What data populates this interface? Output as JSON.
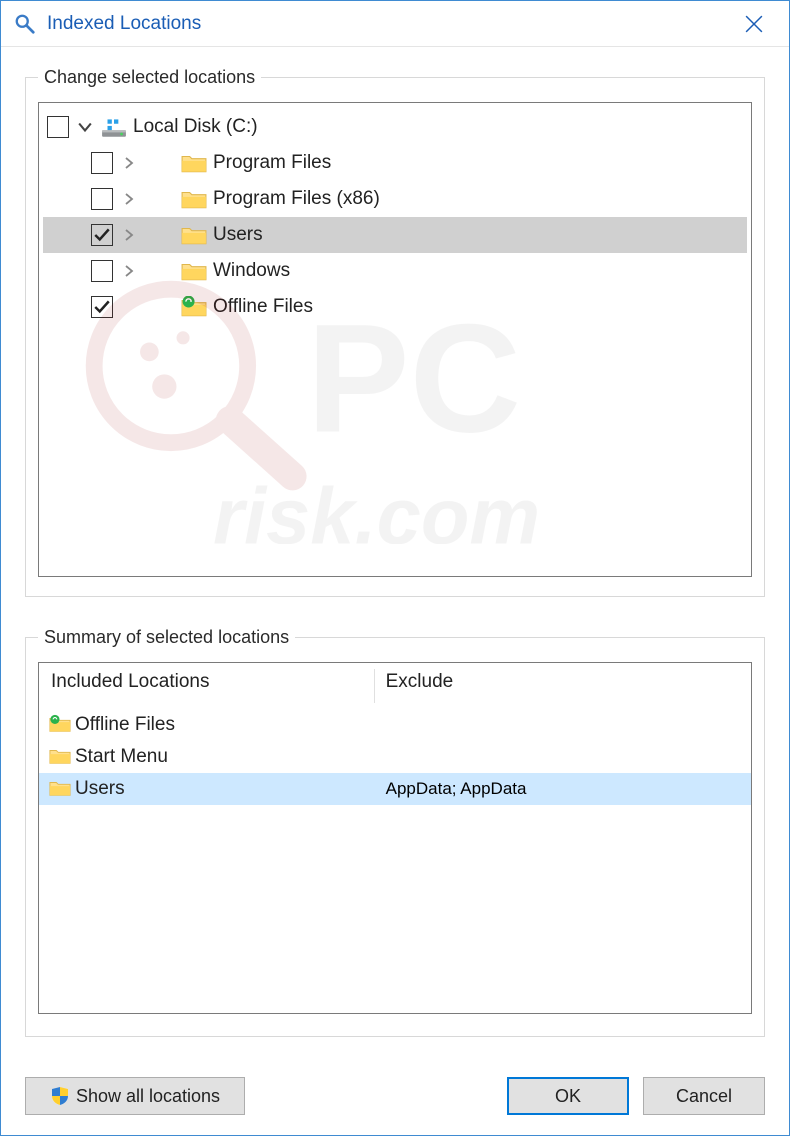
{
  "title": "Indexed Locations",
  "fieldset_top_legend": "Change selected locations",
  "fieldset_bottom_legend": "Summary of selected locations",
  "tree": [
    {
      "label": "Local Disk (C:)",
      "checked": false,
      "expanded": true,
      "icon": "disk",
      "depth": 0,
      "selected": false
    },
    {
      "label": "Program Files",
      "checked": false,
      "expanded": false,
      "icon": "folder",
      "depth": 1,
      "selected": false
    },
    {
      "label": "Program Files (x86)",
      "checked": false,
      "expanded": false,
      "icon": "folder",
      "depth": 1,
      "selected": false
    },
    {
      "label": "Users",
      "checked": true,
      "expanded": false,
      "icon": "folder",
      "depth": 1,
      "selected": true
    },
    {
      "label": "Windows",
      "checked": false,
      "expanded": false,
      "icon": "folder",
      "depth": 1,
      "selected": false
    },
    {
      "label": "Offline Files",
      "checked": true,
      "expanded": null,
      "icon": "offline",
      "depth": 1,
      "selected": false
    }
  ],
  "summary": {
    "included_header": "Included Locations",
    "exclude_header": "Exclude",
    "rows": [
      {
        "label": "Offline Files",
        "icon": "offline",
        "exclude": "",
        "selected": false
      },
      {
        "label": "Start Menu",
        "icon": "folder",
        "exclude": "",
        "selected": false
      },
      {
        "label": "Users",
        "icon": "folder",
        "exclude": "AppData; AppData",
        "selected": true
      }
    ]
  },
  "buttons": {
    "show_all": "Show all locations",
    "ok": "OK",
    "cancel": "Cancel"
  }
}
